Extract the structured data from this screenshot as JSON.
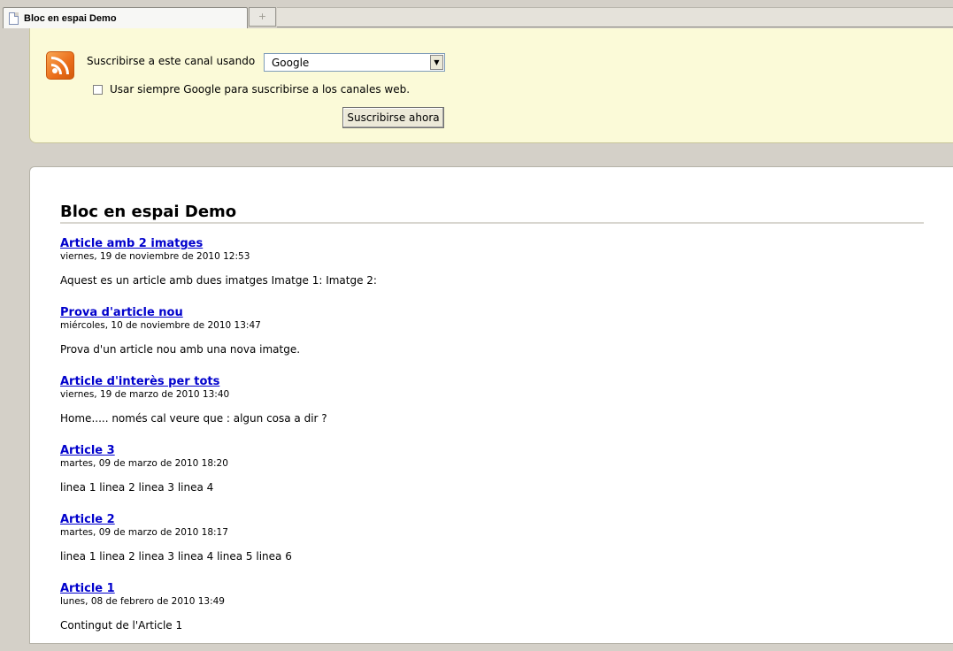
{
  "tab": {
    "title": "Bloc en espai Demo",
    "new_tab_glyph": "+"
  },
  "subscribe": {
    "label": "Suscribirse a este canal usando",
    "reader": "Google",
    "always_label": "Usar siempre Google para suscribirse a los canales web.",
    "button": "Suscribirse ahora"
  },
  "feed": {
    "title": "Bloc en espai Demo",
    "entries": [
      {
        "title": "Article amb 2 imatges",
        "date": "viernes, 19 de noviembre de 2010 12:53",
        "body": "Aquest es un article amb dues imatges Imatge 1: Imatge 2:"
      },
      {
        "title": "Prova d'article nou",
        "date": "miércoles, 10 de noviembre de 2010 13:47",
        "body": "Prova d'un article nou amb una nova imatge."
      },
      {
        "title": "Article d'interès per tots",
        "date": "viernes, 19 de marzo de 2010 13:40",
        "body": "Home..... només cal veure que : algun cosa a dir ?"
      },
      {
        "title": "Article 3",
        "date": "martes, 09 de marzo de 2010 18:20",
        "body": "linea 1 linea 2 linea 3 linea 4"
      },
      {
        "title": "Article 2",
        "date": "martes, 09 de marzo de 2010 18:17",
        "body": "linea 1 linea 2 linea 3 linea 4 linea 5 linea 6"
      },
      {
        "title": "Article 1",
        "date": "lunes, 08 de febrero de 2010 13:49",
        "body": "Contingut de l'Article 1"
      }
    ]
  }
}
